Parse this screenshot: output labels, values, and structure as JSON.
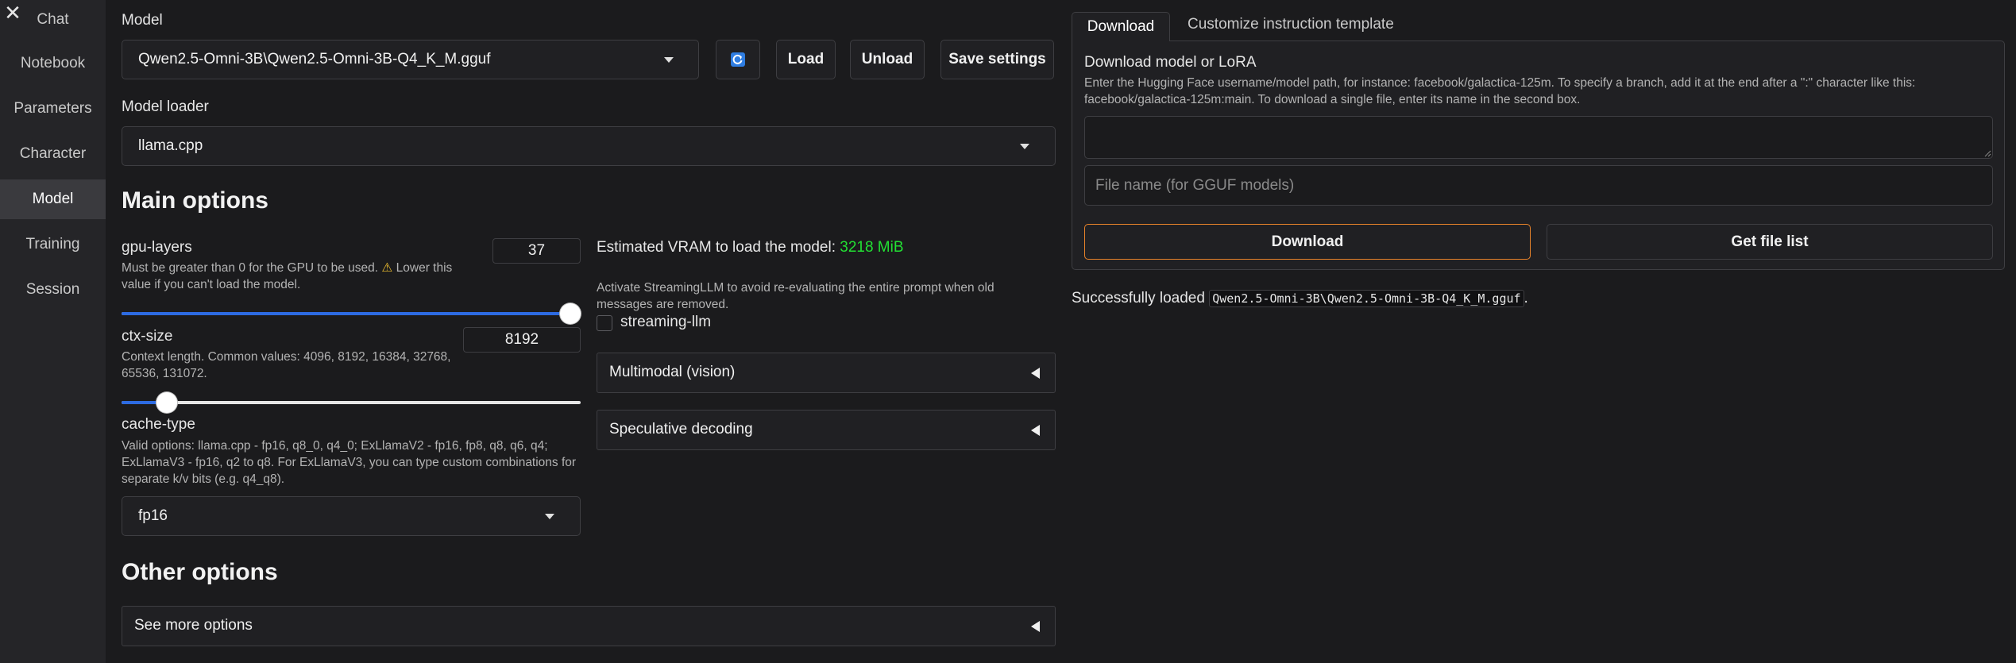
{
  "sidebar": {
    "close_glyph": "✕",
    "items": [
      {
        "label": "Chat"
      },
      {
        "label": "Notebook"
      },
      {
        "label": "Parameters"
      },
      {
        "label": "Character"
      },
      {
        "label": "Model",
        "active": true
      },
      {
        "label": "Training"
      },
      {
        "label": "Session"
      }
    ]
  },
  "model": {
    "label": "Model",
    "selected": "Qwen2.5-Omni-3B\\Qwen2.5-Omni-3B-Q4_K_M.gguf",
    "refresh_icon": "refresh-icon",
    "load_label": "Load",
    "unload_label": "Unload",
    "save_label": "Save settings"
  },
  "loader": {
    "label": "Model loader",
    "selected": "llama.cpp"
  },
  "main_options": {
    "title": "Main options",
    "gpu_layers": {
      "label": "gpu-layers",
      "hint1": "Must be greater than 0 for the GPU to be used.",
      "warn_glyph": "⚠",
      "hint2": "Lower this",
      "hint3": "value if you can't load the model.",
      "value": "37",
      "slider_fraction": 1.0
    },
    "ctx_size": {
      "label": "ctx-size",
      "hint1": "Context length. Common values: 4096, 8192, 16384, 32768,",
      "hint2": "65536, 131072.",
      "value": "8192",
      "slider_fraction": 0.08
    },
    "cache_type": {
      "label": "cache-type",
      "hint1": "Valid options: llama.cpp - fp16, q8_0, q4_0; ExLlamaV2 - fp16, fp8, q8, q6, q4;",
      "hint2": "ExLlamaV3 - fp16, q2 to q8. For ExLlamaV3, you can type custom combinations for",
      "hint3": "separate k/v bits (e.g. q4_q8).",
      "selected": "fp16"
    },
    "vram": {
      "label": "Estimated VRAM to load the model:",
      "value": "3218 MiB",
      "value_color": "#22e033"
    },
    "streaming": {
      "hint1": "Activate StreamingLLM to avoid re-evaluating the entire prompt when old",
      "hint2": "messages are removed.",
      "label": "streaming-llm",
      "checked": false
    },
    "multimodal": "Multimodal (vision)",
    "speculative": "Speculative decoding"
  },
  "other_options": {
    "title": "Other options",
    "see_more": "See more options"
  },
  "right_panel": {
    "tabs": [
      {
        "label": "Download",
        "active": true
      },
      {
        "label": "Customize instruction template",
        "active": false
      }
    ],
    "download": {
      "title": "Download model or LoRA",
      "hint1": "Enter the Hugging Face username/model path, for instance: facebook/galactica-125m. To specify a branch, add it at the end after a \":\" character like this:",
      "hint2": "facebook/galactica-125m:main. To download a single file, enter its name in the second box.",
      "repo_value": "",
      "file_placeholder": "File name (for GGUF models)",
      "download_label": "Download",
      "download_border_color": "#e8832a",
      "file_list_label": "Get file list"
    },
    "status": {
      "prefix": "Successfully loaded",
      "filename": "Qwen2.5-Omni-3B\\Qwen2.5-Omni-3B-Q4_K_M.gguf",
      "suffix": "."
    }
  }
}
